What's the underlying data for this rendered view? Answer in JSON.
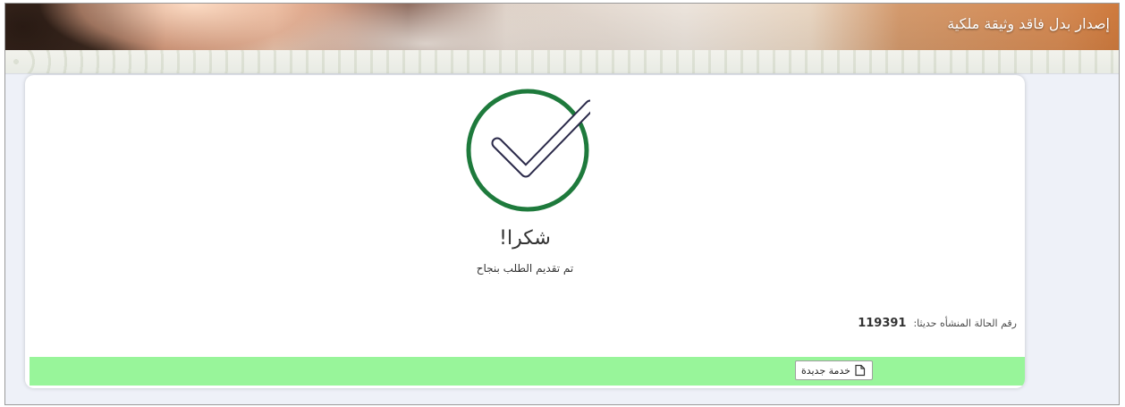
{
  "header": {
    "title": "إصدار بدل فاقد وثيقة ملكية"
  },
  "confirmation": {
    "check_icon": "checkmark-circle-icon",
    "heading": "شكرا!",
    "message": "تم تقديم الطلب بنجاح",
    "case_label": "رقم الحالة المنشأه حديثا:",
    "case_number": "119391"
  },
  "footer": {
    "new_service_label": "خدمة جديدة",
    "new_service_icon": "new-document-icon"
  },
  "colors": {
    "check_ring": "#1e7a3c",
    "check_mark": "#2b2a4a",
    "footer_bar": "#98f59a"
  }
}
